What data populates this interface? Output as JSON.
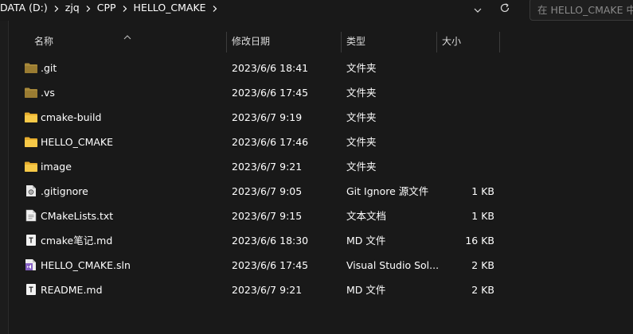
{
  "breadcrumb": {
    "items": [
      "DATA (D:)",
      "zjq",
      "CPP",
      "HELLO_CMAKE"
    ]
  },
  "search": {
    "placeholder": "在 HELLO_CMAKE 中搜索"
  },
  "columns": {
    "name": "名称",
    "date": "修改日期",
    "type": "类型",
    "size": "大小"
  },
  "files": [
    {
      "name": ".git",
      "date": "2023/6/6 18:41",
      "type": "文件夹",
      "size": "",
      "icon": "folder-dim-icon"
    },
    {
      "name": ".vs",
      "date": "2023/6/6 17:45",
      "type": "文件夹",
      "size": "",
      "icon": "folder-dim-icon"
    },
    {
      "name": "cmake-build",
      "date": "2023/6/7 9:19",
      "type": "文件夹",
      "size": "",
      "icon": "folder-icon"
    },
    {
      "name": "HELLO_CMAKE",
      "date": "2023/6/6 17:46",
      "type": "文件夹",
      "size": "",
      "icon": "folder-icon"
    },
    {
      "name": "image",
      "date": "2023/6/7 9:21",
      "type": "文件夹",
      "size": "",
      "icon": "folder-icon"
    },
    {
      "name": ".gitignore",
      "date": "2023/6/7 9:05",
      "type": "Git Ignore 源文件",
      "size": "1 KB",
      "icon": "gitignore-file-icon"
    },
    {
      "name": "CMakeLists.txt",
      "date": "2023/6/7 9:15",
      "type": "文本文档",
      "size": "1 KB",
      "icon": "text-file-icon"
    },
    {
      "name": "cmake笔记.md",
      "date": "2023/6/6 18:30",
      "type": "MD 文件",
      "size": "16 KB",
      "icon": "markdown-file-icon"
    },
    {
      "name": "HELLO_CMAKE.sln",
      "date": "2023/6/6 17:45",
      "type": "Visual Studio Sol...",
      "size": "2 KB",
      "icon": "visual-studio-solution-icon"
    },
    {
      "name": "README.md",
      "date": "2023/6/7 9:21",
      "type": "MD 文件",
      "size": "2 KB",
      "icon": "markdown-file-icon"
    }
  ],
  "colors": {
    "background": "#191919",
    "folder": "#f0c24b",
    "folder_dim": "#a8893a",
    "vs_purple": "#8661c5"
  }
}
